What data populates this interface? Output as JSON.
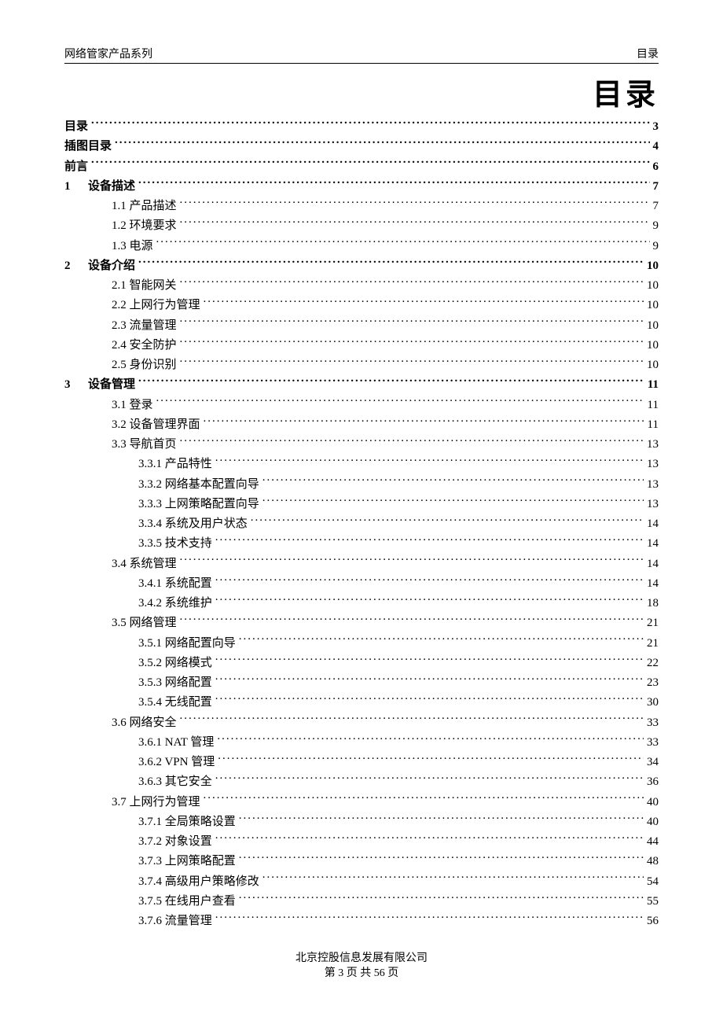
{
  "header": {
    "left": "网络管家产品系列",
    "right": "目录"
  },
  "title": "目录",
  "toc": [
    {
      "num": "",
      "label": "目录",
      "page": "3",
      "bold": true,
      "indent": 0
    },
    {
      "num": "",
      "label": "插图目录",
      "page": "4",
      "bold": true,
      "indent": 0
    },
    {
      "num": "",
      "label": "前言",
      "page": "6",
      "bold": true,
      "indent": 0
    },
    {
      "num": "1",
      "label": "设备描述",
      "page": "7",
      "bold": true,
      "indent": 0
    },
    {
      "num": "",
      "label": "1.1  产品描述",
      "page": "7",
      "bold": false,
      "indent": 1
    },
    {
      "num": "",
      "label": "1.2  环境要求",
      "page": "9",
      "bold": false,
      "indent": 1
    },
    {
      "num": "",
      "label": "1.3  电源",
      "page": "9",
      "bold": false,
      "indent": 1
    },
    {
      "num": "2",
      "label": "设备介绍",
      "page": "10",
      "bold": true,
      "indent": 0
    },
    {
      "num": "",
      "label": "2.1  智能网关",
      "page": "10",
      "bold": false,
      "indent": 1
    },
    {
      "num": "",
      "label": "2.2 上网行为管理",
      "page": "10",
      "bold": false,
      "indent": 1
    },
    {
      "num": "",
      "label": "2.3 流量管理",
      "page": "10",
      "bold": false,
      "indent": 1
    },
    {
      "num": "",
      "label": "2.4 安全防护",
      "page": "10",
      "bold": false,
      "indent": 1
    },
    {
      "num": "",
      "label": "2.5 身份识别",
      "page": "10",
      "bold": false,
      "indent": 1
    },
    {
      "num": "3",
      "label": "设备管理",
      "page": "11",
      "bold": true,
      "indent": 0
    },
    {
      "num": "",
      "label": "3.1  登录",
      "page": "11",
      "bold": false,
      "indent": 1
    },
    {
      "num": "",
      "label": "3.2  设备管理界面",
      "page": "11",
      "bold": false,
      "indent": 1
    },
    {
      "num": "",
      "label": "3.3  导航首页",
      "page": "13",
      "bold": false,
      "indent": 1
    },
    {
      "num": "",
      "label": "3.3.1  产品特性",
      "page": "13",
      "bold": false,
      "indent": 2
    },
    {
      "num": "",
      "label": "3.3.2  网络基本配置向导",
      "page": "13",
      "bold": false,
      "indent": 2
    },
    {
      "num": "",
      "label": "3.3.3  上网策略配置向导",
      "page": "13",
      "bold": false,
      "indent": 2
    },
    {
      "num": "",
      "label": "3.3.4  系统及用户状态",
      "page": "14",
      "bold": false,
      "indent": 2
    },
    {
      "num": "",
      "label": "3.3.5  技术支持",
      "page": "14",
      "bold": false,
      "indent": 2
    },
    {
      "num": "",
      "label": "3.4  系统管理",
      "page": "14",
      "bold": false,
      "indent": 1
    },
    {
      "num": "",
      "label": "3.4.1  系统配置",
      "page": "14",
      "bold": false,
      "indent": 2
    },
    {
      "num": "",
      "label": "3.4.2  系统维护",
      "page": "18",
      "bold": false,
      "indent": 2
    },
    {
      "num": "",
      "label": "3.5  网络管理",
      "page": "21",
      "bold": false,
      "indent": 1
    },
    {
      "num": "",
      "label": "3.5.1  网络配置向导",
      "page": "21",
      "bold": false,
      "indent": 2
    },
    {
      "num": "",
      "label": "3.5.2  网络模式",
      "page": "22",
      "bold": false,
      "indent": 2
    },
    {
      "num": "",
      "label": "3.5.3  网络配置",
      "page": "23",
      "bold": false,
      "indent": 2
    },
    {
      "num": "",
      "label": "3.5.4  无线配置",
      "page": "30",
      "bold": false,
      "indent": 2
    },
    {
      "num": "",
      "label": "3.6  网络安全",
      "page": "33",
      "bold": false,
      "indent": 1
    },
    {
      "num": "",
      "label": "3.6.1 NAT 管理",
      "page": "33",
      "bold": false,
      "indent": 2
    },
    {
      "num": "",
      "label": "3.6.2 VPN 管理",
      "page": "34",
      "bold": false,
      "indent": 2
    },
    {
      "num": "",
      "label": "3.6.3  其它安全",
      "page": "36",
      "bold": false,
      "indent": 2
    },
    {
      "num": "",
      "label": "3.7  上网行为管理",
      "page": "40",
      "bold": false,
      "indent": 1
    },
    {
      "num": "",
      "label": "3.7.1  全局策略设置",
      "page": "40",
      "bold": false,
      "indent": 2
    },
    {
      "num": "",
      "label": "3.7.2  对象设置",
      "page": "44",
      "bold": false,
      "indent": 2
    },
    {
      "num": "",
      "label": "3.7.3  上网策略配置",
      "page": "48",
      "bold": false,
      "indent": 2
    },
    {
      "num": "",
      "label": "3.7.4  高级用户策略修改",
      "page": "54",
      "bold": false,
      "indent": 2
    },
    {
      "num": "",
      "label": "3.7.5  在线用户查看",
      "page": "55",
      "bold": false,
      "indent": 2
    },
    {
      "num": "",
      "label": "3.7.6  流量管理",
      "page": "56",
      "bold": false,
      "indent": 2
    }
  ],
  "footer": {
    "company": "北京控股信息发展有限公司",
    "pagination_prefix": "第 ",
    "page_current": "3",
    "pagination_mid": " 页  共 ",
    "page_total": "56",
    "pagination_suffix": " 页"
  }
}
